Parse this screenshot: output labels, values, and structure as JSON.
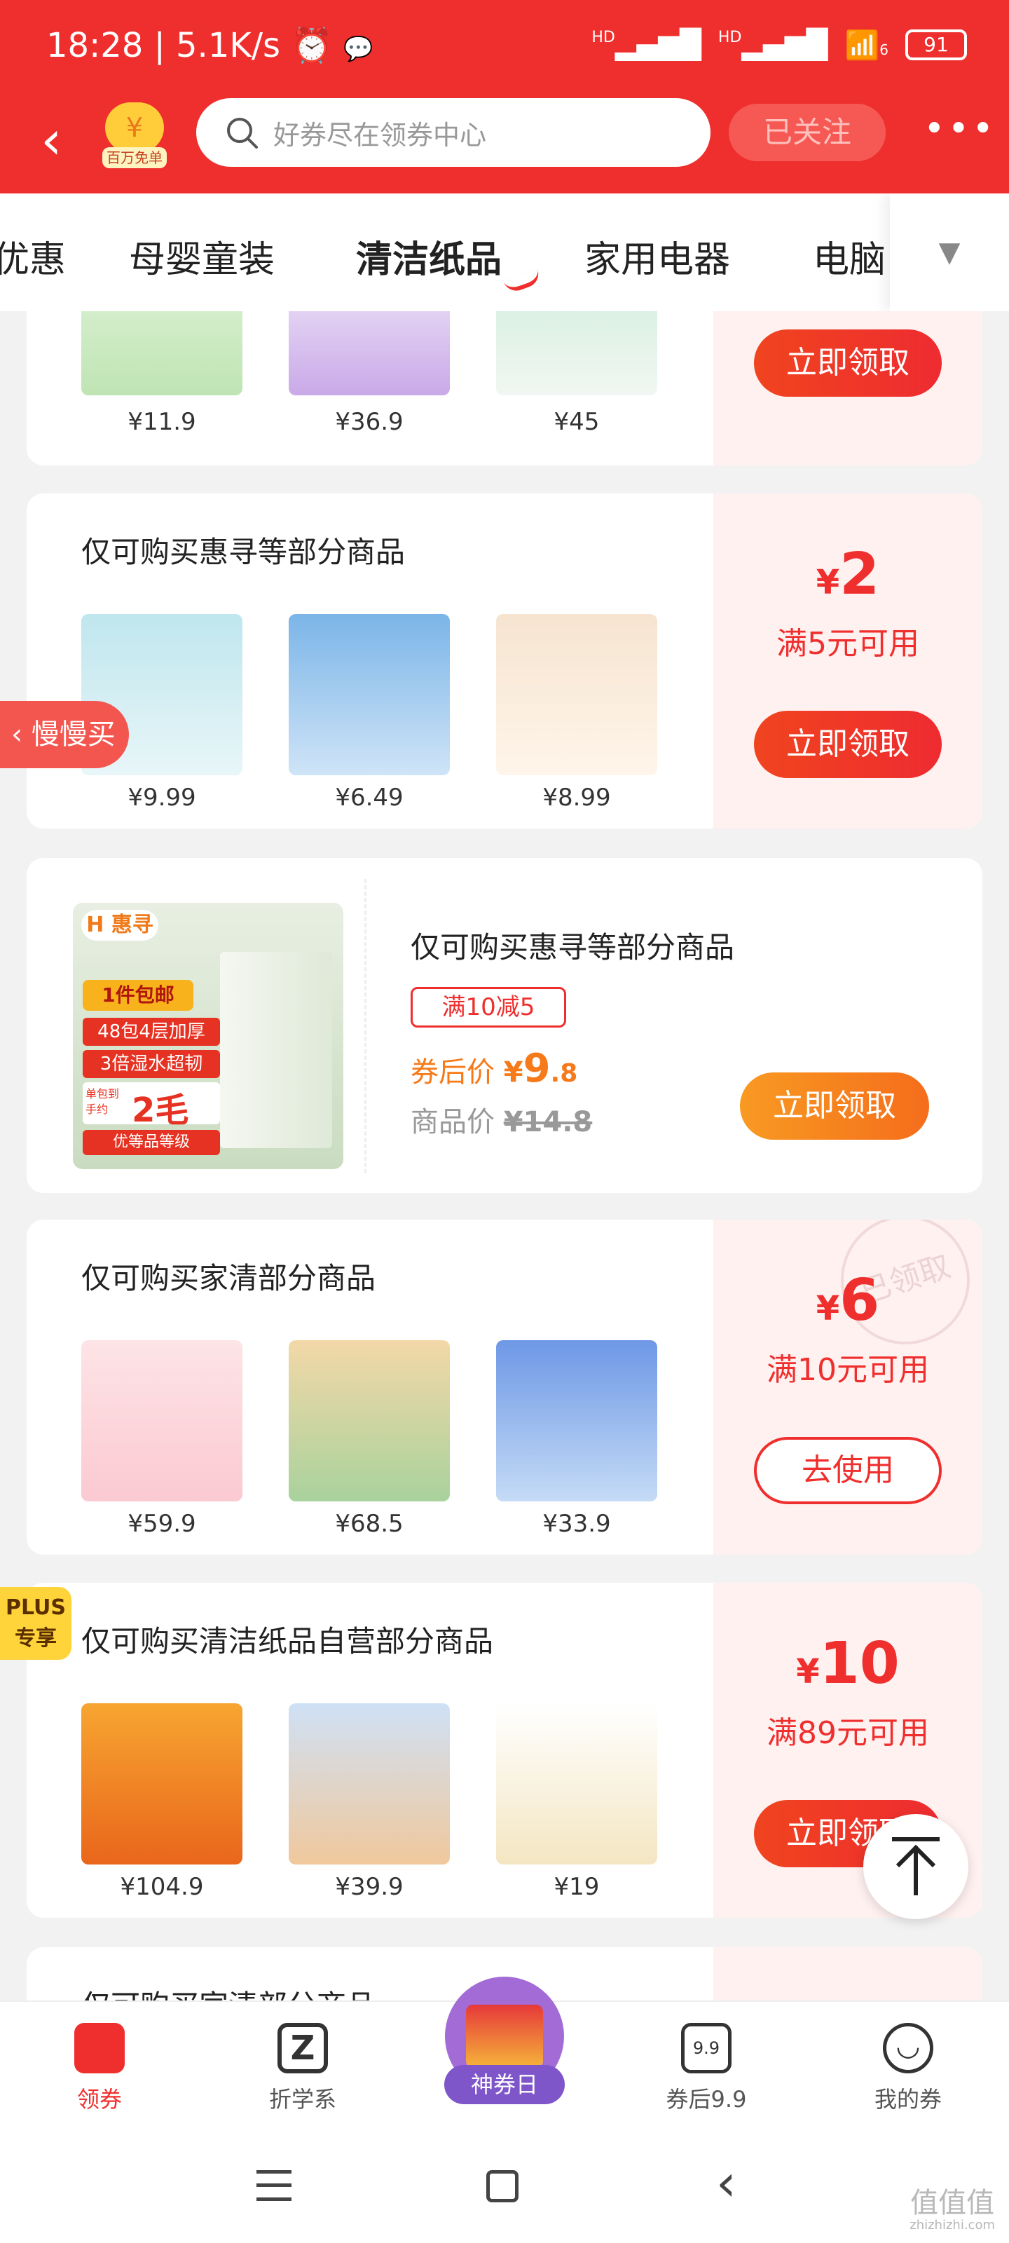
{
  "status": {
    "time": "18:28",
    "speed": "5.1K/s",
    "net1": "HD",
    "net2": "HD",
    "wifi_sub": "6",
    "battery": "91"
  },
  "header": {
    "back_icon": "chevron-left-icon",
    "badge_symbol": "¥",
    "badge_label": "百万免单",
    "search_placeholder": "好券尽在领券中心",
    "follow_label": "已关注",
    "more_label": "•••"
  },
  "tabs": [
    {
      "label": "优惠"
    },
    {
      "label": "母婴童装"
    },
    {
      "label": "清洁纸品",
      "active": true
    },
    {
      "label": "家用电器"
    },
    {
      "label": "电脑"
    }
  ],
  "cards": [
    {
      "title": "",
      "prices": [
        "¥11.9",
        "¥36.9",
        "¥45"
      ],
      "button": "立即领取"
    },
    {
      "title": "仅可购买惠寻等部分商品",
      "prices": [
        "¥9.99",
        "¥6.49",
        "¥8.99"
      ],
      "amount": "2",
      "currency": "¥",
      "condition": "满5元可用",
      "button": "立即领取"
    },
    {
      "title": "仅可购买惠寻等部分商品",
      "tag": "满10减5",
      "after_label": "券后价",
      "after_currency": "¥",
      "after_int": "9",
      "after_dec": ".8",
      "orig_label": "商品价",
      "orig_price": "¥14.8",
      "button": "立即领取",
      "image_brand": "惠寻",
      "image_texts": [
        "1件包邮",
        "48包4层加厚",
        "3倍湿水超韧",
        "单包到手约",
        "2毛",
        "优等品等级"
      ]
    },
    {
      "title": "仅可购买家清部分商品",
      "prices": [
        "¥59.9",
        "¥68.5",
        "¥33.9"
      ],
      "amount": "6",
      "currency": "¥",
      "condition": "满10元可用",
      "button": "去使用",
      "stamp": "已领取"
    },
    {
      "title": "仅可购买清洁纸品自营部分商品",
      "prices": [
        "¥104.9",
        "¥39.9",
        "¥19"
      ],
      "amount": "10",
      "currency": "¥",
      "condition": "满89元可用",
      "button": "立即领取"
    },
    {
      "title": "仅可购买家清部分商品"
    }
  ],
  "floats": {
    "slow_buy": "慢慢买",
    "plus_line1": "PLUS",
    "plus_line2": "专享"
  },
  "bottom_nav": [
    {
      "label": "领券",
      "icon": "coupon-icon",
      "active": true
    },
    {
      "label": "折学系",
      "icon": "z-icon"
    },
    {
      "label": "神券日",
      "icon": "gift-box-icon"
    },
    {
      "label": "券后9.9",
      "icon": "nine-nine-icon",
      "icon_text": "9.9"
    },
    {
      "label": "我的券",
      "icon": "smile-icon"
    }
  ],
  "watermark": {
    "text": "值值值",
    "sub": "zhizhizhi.com"
  },
  "colors": {
    "primary": "#ef2f2e",
    "accent_orange": "#f77a1a",
    "plus_yellow": "#ffd43a"
  }
}
